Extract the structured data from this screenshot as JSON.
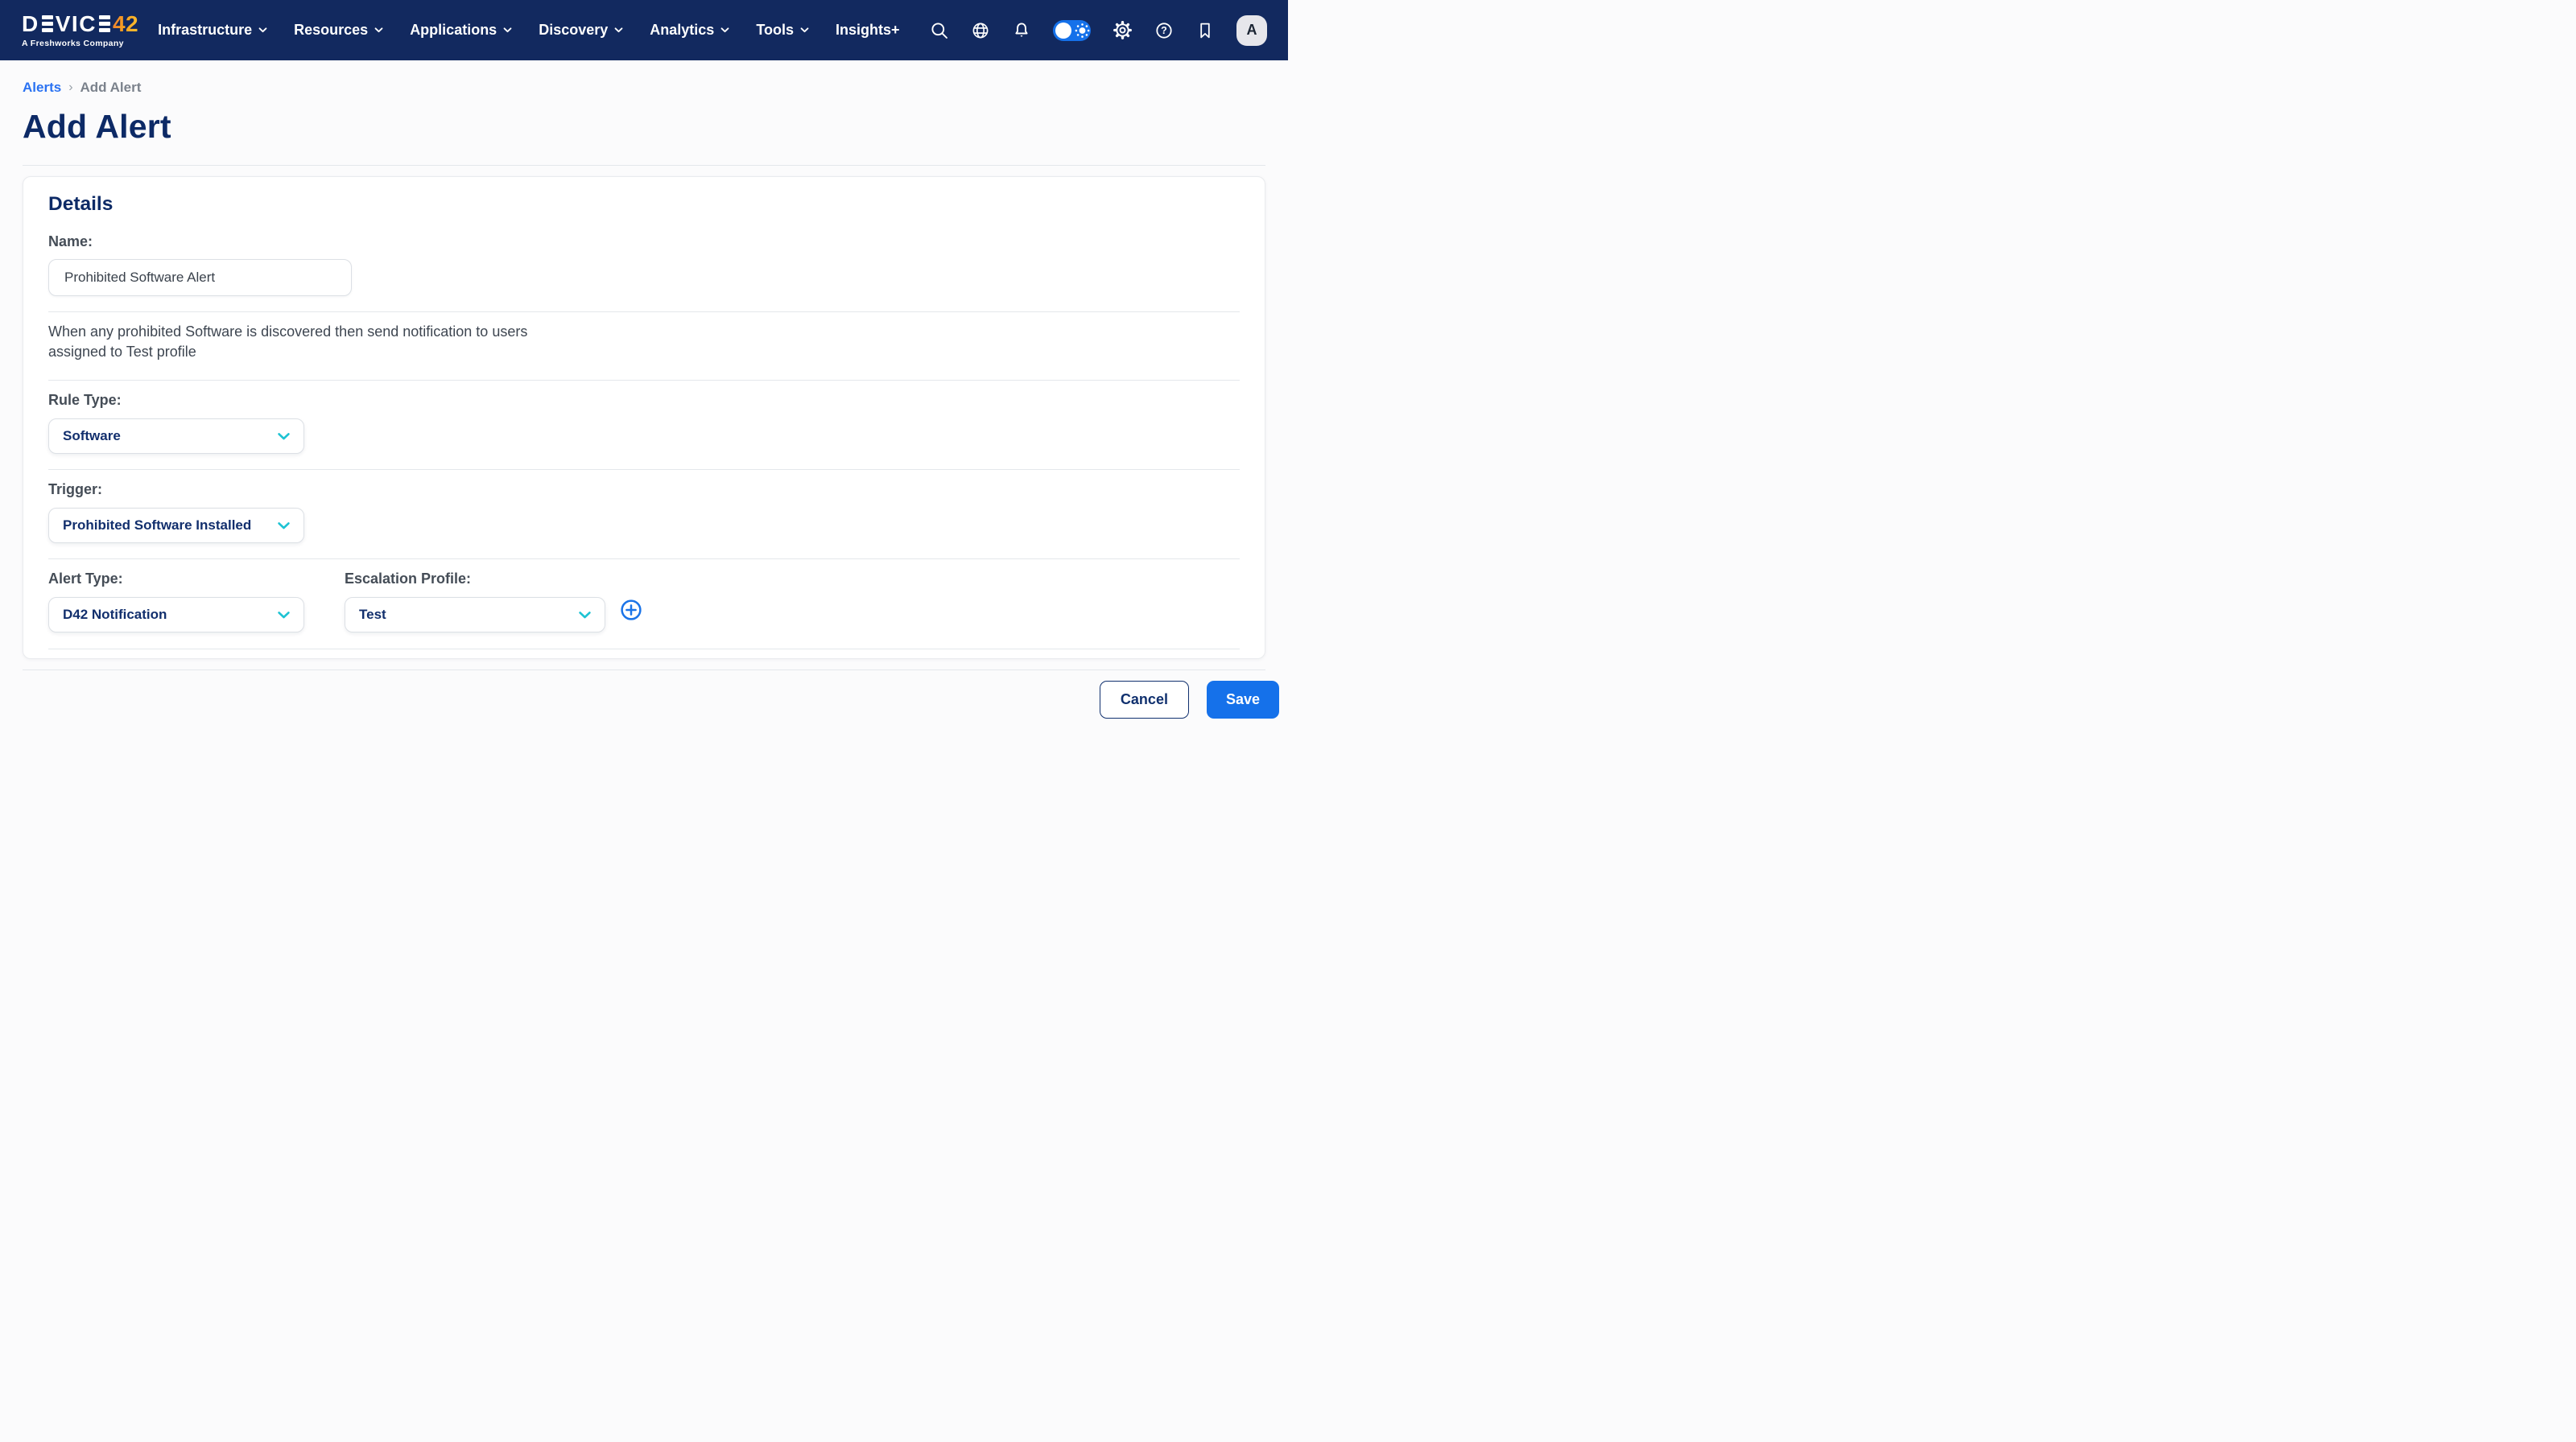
{
  "app": {
    "name": "Device42"
  },
  "navbar": {
    "logo": {
      "text": "DEVICE42",
      "tagline": "A Freshworks Company"
    },
    "items": [
      {
        "label": "Infrastructure",
        "has_dropdown": true
      },
      {
        "label": "Resources",
        "has_dropdown": true
      },
      {
        "label": "Applications",
        "has_dropdown": true
      },
      {
        "label": "Discovery",
        "has_dropdown": true
      },
      {
        "label": "Analytics",
        "has_dropdown": true
      },
      {
        "label": "Tools",
        "has_dropdown": true
      },
      {
        "label": "Insights+",
        "has_dropdown": false
      }
    ],
    "icons": [
      "search-icon",
      "globe-icon",
      "notifications-bell-icon",
      "theme-toggle",
      "settings-gear-icon",
      "help-icon",
      "bookmark-icon"
    ],
    "theme_toggle": {
      "state": "on"
    },
    "avatar_initial": "A"
  },
  "breadcrumb": {
    "parent": "Alerts",
    "separator": "›",
    "current": "Add Alert"
  },
  "page": {
    "title": "Add Alert"
  },
  "form": {
    "section_title": "Details",
    "name": {
      "label": "Name:",
      "value": "Prohibited Software Alert"
    },
    "description": {
      "line1": "When any prohibited Software is discovered then send notification to users",
      "line2": "assigned to Test profile"
    },
    "rule_type": {
      "label": "Rule Type:",
      "value": "Software"
    },
    "trigger": {
      "label": "Trigger:",
      "value": "Prohibited Software Installed"
    },
    "alert_type": {
      "label": "Alert Type:",
      "value": "D42 Notification"
    },
    "escalation_profile": {
      "label": "Escalation Profile:",
      "value": "Test"
    }
  },
  "actions": {
    "cancel_label": "Cancel",
    "save_label": "Save"
  },
  "colors": {
    "navbar_bg": "#12295F",
    "accent_blue": "#1571EA",
    "link_blue": "#2A72F2",
    "heading_navy": "#0D2A66",
    "dropdown_text_navy": "#122F6D",
    "chevron_teal": "#1EC3D3",
    "logo_orange": "#F6A020",
    "label_gray": "#454D57",
    "divider_gray": "#E4E7EB"
  }
}
